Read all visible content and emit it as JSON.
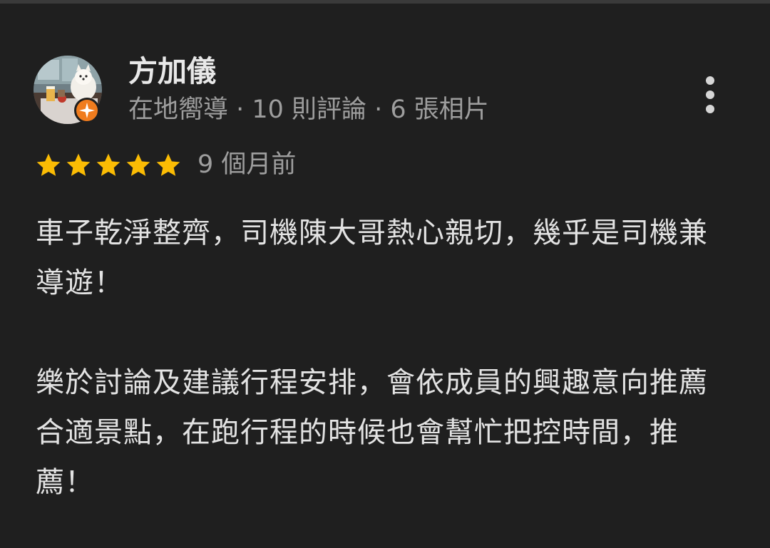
{
  "review": {
    "author": {
      "name": "方加儀",
      "meta": "在地嚮導 · 10 則評論 · 6 張相片",
      "badge_icon": "local-guide-star-icon",
      "badge_color": "#f07c1e"
    },
    "rating": {
      "stars": 5,
      "max_stars": 5,
      "star_color": "#fbbc04"
    },
    "time_ago": "9 個月前",
    "paragraphs": [
      "車子乾淨整齊，司機陳大哥熱心親切，幾乎是司機兼導遊！",
      "樂於討論及建議行程安排，會依成員的興趣意向推薦合適景點，在跑行程的時候也會幫忙把控時間，推薦！"
    ]
  },
  "more_menu_icon": "more-vert-icon",
  "colors": {
    "background": "#1f1f1f",
    "text_primary": "#e3e3e3",
    "text_secondary": "#9e9e9e"
  }
}
